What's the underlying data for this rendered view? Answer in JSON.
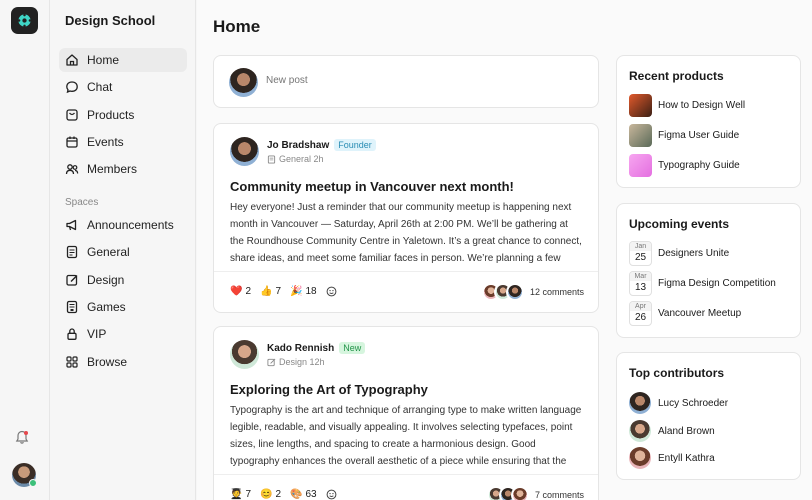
{
  "sidebar": {
    "brand": "Design School",
    "nav": [
      {
        "label": "Home",
        "icon": "home-icon"
      },
      {
        "label": "Chat",
        "icon": "chat-icon"
      },
      {
        "label": "Products",
        "icon": "products-icon"
      },
      {
        "label": "Events",
        "icon": "calendar-icon"
      },
      {
        "label": "Members",
        "icon": "members-icon"
      }
    ],
    "spaces_label": "Spaces",
    "spaces": [
      {
        "label": "Announcements",
        "icon": "megaphone-icon"
      },
      {
        "label": "General",
        "icon": "document-icon"
      },
      {
        "label": "Design",
        "icon": "edit-icon"
      },
      {
        "label": "Games",
        "icon": "gamepad-icon"
      },
      {
        "label": "VIP",
        "icon": "lock-icon"
      },
      {
        "label": "Browse",
        "icon": "grid-icon"
      }
    ]
  },
  "main": {
    "title": "Home",
    "new_post_placeholder": "New post",
    "posts": [
      {
        "author": "Jo Bradshaw",
        "badge": "Founder",
        "space": "General",
        "time": "2h",
        "title": "Community meetup in Vancouver next month!",
        "body": "Hey everyone! Just a reminder that our community meetup is happening next month in Vancouver — Saturday, April 26th at 2:00 PM. We’ll be gathering at the Roundhouse Community Centre in Yaletown. It’s a great chance to connect, share ideas, and meet some familiar faces in person. We’re planning a few short…",
        "reactions": [
          {
            "emoji": "❤️",
            "count": "2"
          },
          {
            "emoji": "👍",
            "count": "7"
          },
          {
            "emoji": "🎉",
            "count": "18"
          }
        ],
        "comments": "12 comments"
      },
      {
        "author": "Kado Rennish",
        "badge": "New",
        "space": "Design",
        "time": "12h",
        "title": "Exploring the Art of Typography",
        "body": "Typography is the art and technique of arranging type to make written language legible, readable, and visually appealing. It involves selecting typefaces, point sizes, line lengths, and spacing to create a harmonious design. Good typography enhances the overall aesthetic of a piece while ensuring that the m…",
        "reactions": [
          {
            "emoji": "🧑‍🎓",
            "count": "7"
          },
          {
            "emoji": "😊",
            "count": "2"
          },
          {
            "emoji": "🎨",
            "count": "63"
          }
        ],
        "comments": "7 comments"
      }
    ]
  },
  "right": {
    "recent_products_title": "Recent products",
    "products": [
      "How to Design Well",
      "Figma User Guide",
      "Typography Guide"
    ],
    "upcoming_events_title": "Upcoming events",
    "events": [
      {
        "month": "Jan",
        "day": "25",
        "name": "Designers Unite"
      },
      {
        "month": "Mar",
        "day": "13",
        "name": "Figma Design Competition"
      },
      {
        "month": "Apr",
        "day": "26",
        "name": "Vancouver Meetup"
      }
    ],
    "top_contributors_title": "Top contributors",
    "contributors": [
      "Lucy Schroeder",
      "Aland Brown",
      "Entyll Kathra"
    ]
  },
  "colors": {
    "accent_founder": "#2a8db4",
    "accent_new": "#23944a",
    "online": "#3cc07a",
    "notification": "#e5484d"
  }
}
